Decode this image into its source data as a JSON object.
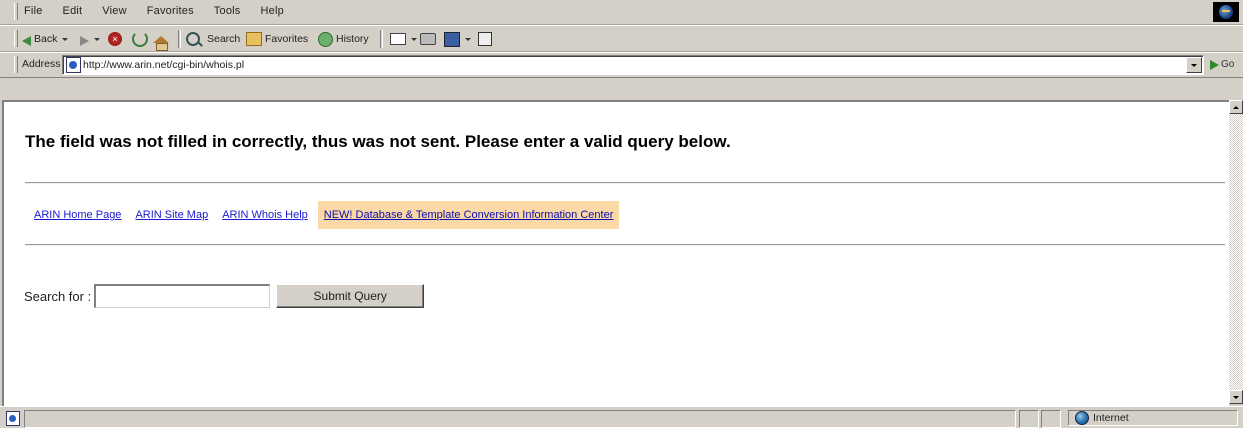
{
  "menu": {
    "items": [
      "File",
      "Edit",
      "View",
      "Favorites",
      "Tools",
      "Help"
    ]
  },
  "toolbar": {
    "back_label": "Back",
    "search_label": "Search",
    "favorites_label": "Favorites",
    "history_label": "History"
  },
  "address_bar": {
    "label": "Address",
    "url": "http://www.arin.net/cgi-bin/whois.pl",
    "go_label": "Go"
  },
  "page": {
    "heading": "The field was not filled in correctly, thus was not sent. Please enter a valid query below.",
    "nav_links": [
      "ARIN Home Page",
      "ARIN Site Map",
      "ARIN Whois Help",
      "NEW! Database & Template Conversion Information Center"
    ],
    "search_label": "Search for :",
    "search_value": "",
    "submit_label": "Submit Query"
  },
  "status_bar": {
    "zone": "Internet"
  },
  "colors": {
    "chrome": "#d4d0c8",
    "link": "#1a1ad0",
    "highlight": "#fbd9a6"
  }
}
